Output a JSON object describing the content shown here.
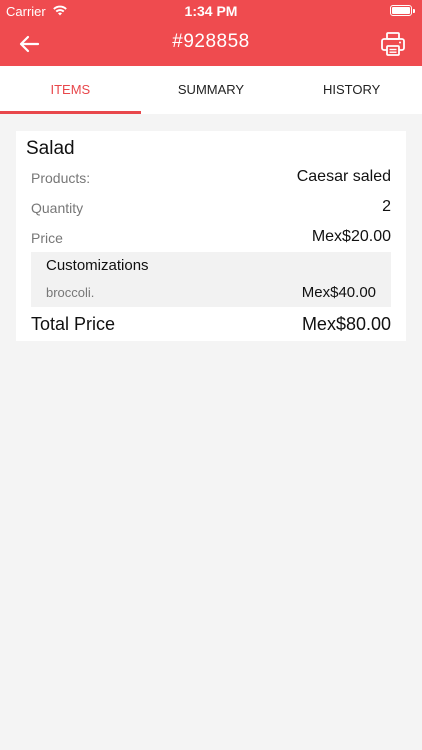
{
  "status_bar": {
    "carrier": "Carrier",
    "time": "1:34 PM"
  },
  "nav": {
    "title": "#928858",
    "back_icon": "arrow-left-icon",
    "print_icon": "printer-icon"
  },
  "tabs": [
    {
      "label": "ITEMS",
      "active": true
    },
    {
      "label": "SUMMARY",
      "active": false
    },
    {
      "label": "HISTORY",
      "active": false
    }
  ],
  "item": {
    "name": "Salad",
    "rows": [
      {
        "label": "Products:",
        "value": "Caesar saled"
      },
      {
        "label": "Quantity",
        "value": "2"
      },
      {
        "label": "Price",
        "value": "Mex$20.00"
      }
    ],
    "customizations": {
      "title": "Customizations",
      "items": [
        {
          "name": "broccoli.",
          "price": "Mex$40.00"
        }
      ]
    },
    "total_label": "Total Price",
    "total_value": "Mex$80.00"
  },
  "colors": {
    "accent": "#ef4b4f",
    "background": "#f4f4f4"
  }
}
